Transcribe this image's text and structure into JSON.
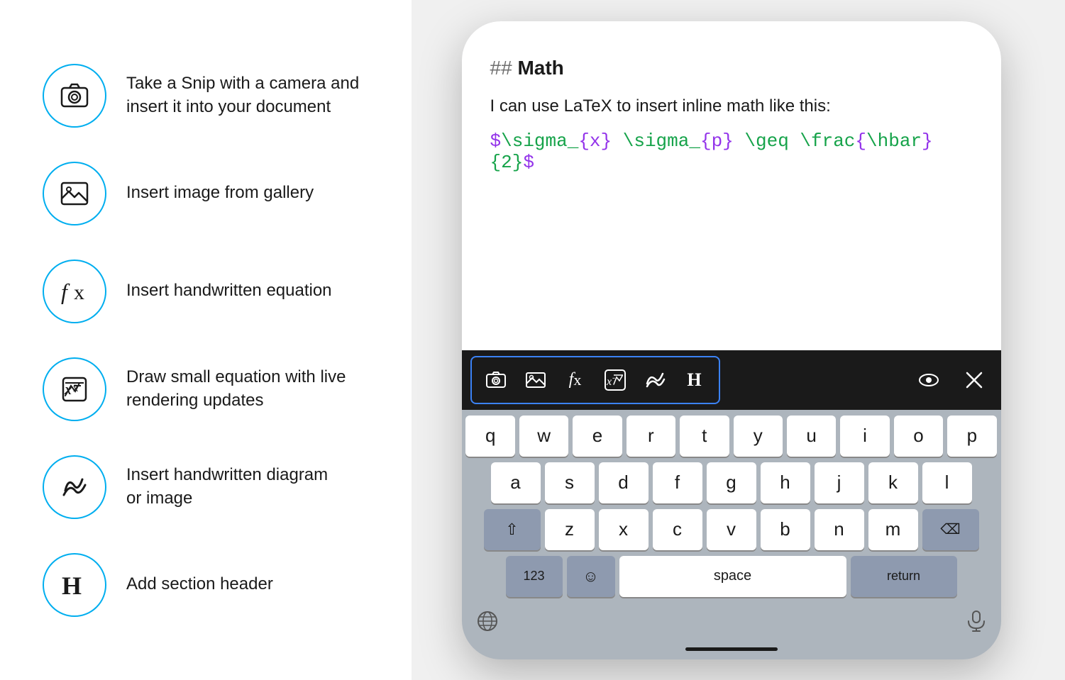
{
  "features": [
    {
      "id": "camera-snip",
      "label": "Take a Snip with a camera and\ninsert it into your document",
      "icon": "camera"
    },
    {
      "id": "insert-image",
      "label": "Insert image from gallery",
      "icon": "image"
    },
    {
      "id": "handwritten-equation",
      "label": "Insert handwritten equation",
      "icon": "fx"
    },
    {
      "id": "draw-equation",
      "label": "Draw small equation with live\nrendering updates",
      "icon": "draw-equation"
    },
    {
      "id": "handwritten-diagram",
      "label": "Insert handwritten diagram\nor image",
      "icon": "scribble"
    },
    {
      "id": "section-header",
      "label": "Add section header",
      "icon": "header"
    }
  ],
  "phone": {
    "doc_prefix": "## ",
    "doc_title": "Math",
    "doc_body": "I can use LaTeX to insert inline math like this:",
    "latex_display": "$\\sigma_{x} \\sigma_{p} \\geq \\frac{\\hbar}{2}$",
    "keyboard": {
      "toolbar_icons": [
        "camera",
        "image",
        "fx",
        "draw-eq",
        "scribble",
        "H"
      ],
      "rows": [
        [
          "q",
          "w",
          "e",
          "r",
          "t",
          "y",
          "u",
          "i",
          "o",
          "p"
        ],
        [
          "a",
          "s",
          "d",
          "f",
          "g",
          "h",
          "j",
          "k",
          "l"
        ],
        [
          "⇧",
          "z",
          "x",
          "c",
          "v",
          "b",
          "n",
          "m",
          "⌫"
        ],
        [
          "123",
          "☺",
          "space",
          "return"
        ]
      ],
      "bottom_icons": [
        "globe",
        "mic"
      ]
    }
  }
}
